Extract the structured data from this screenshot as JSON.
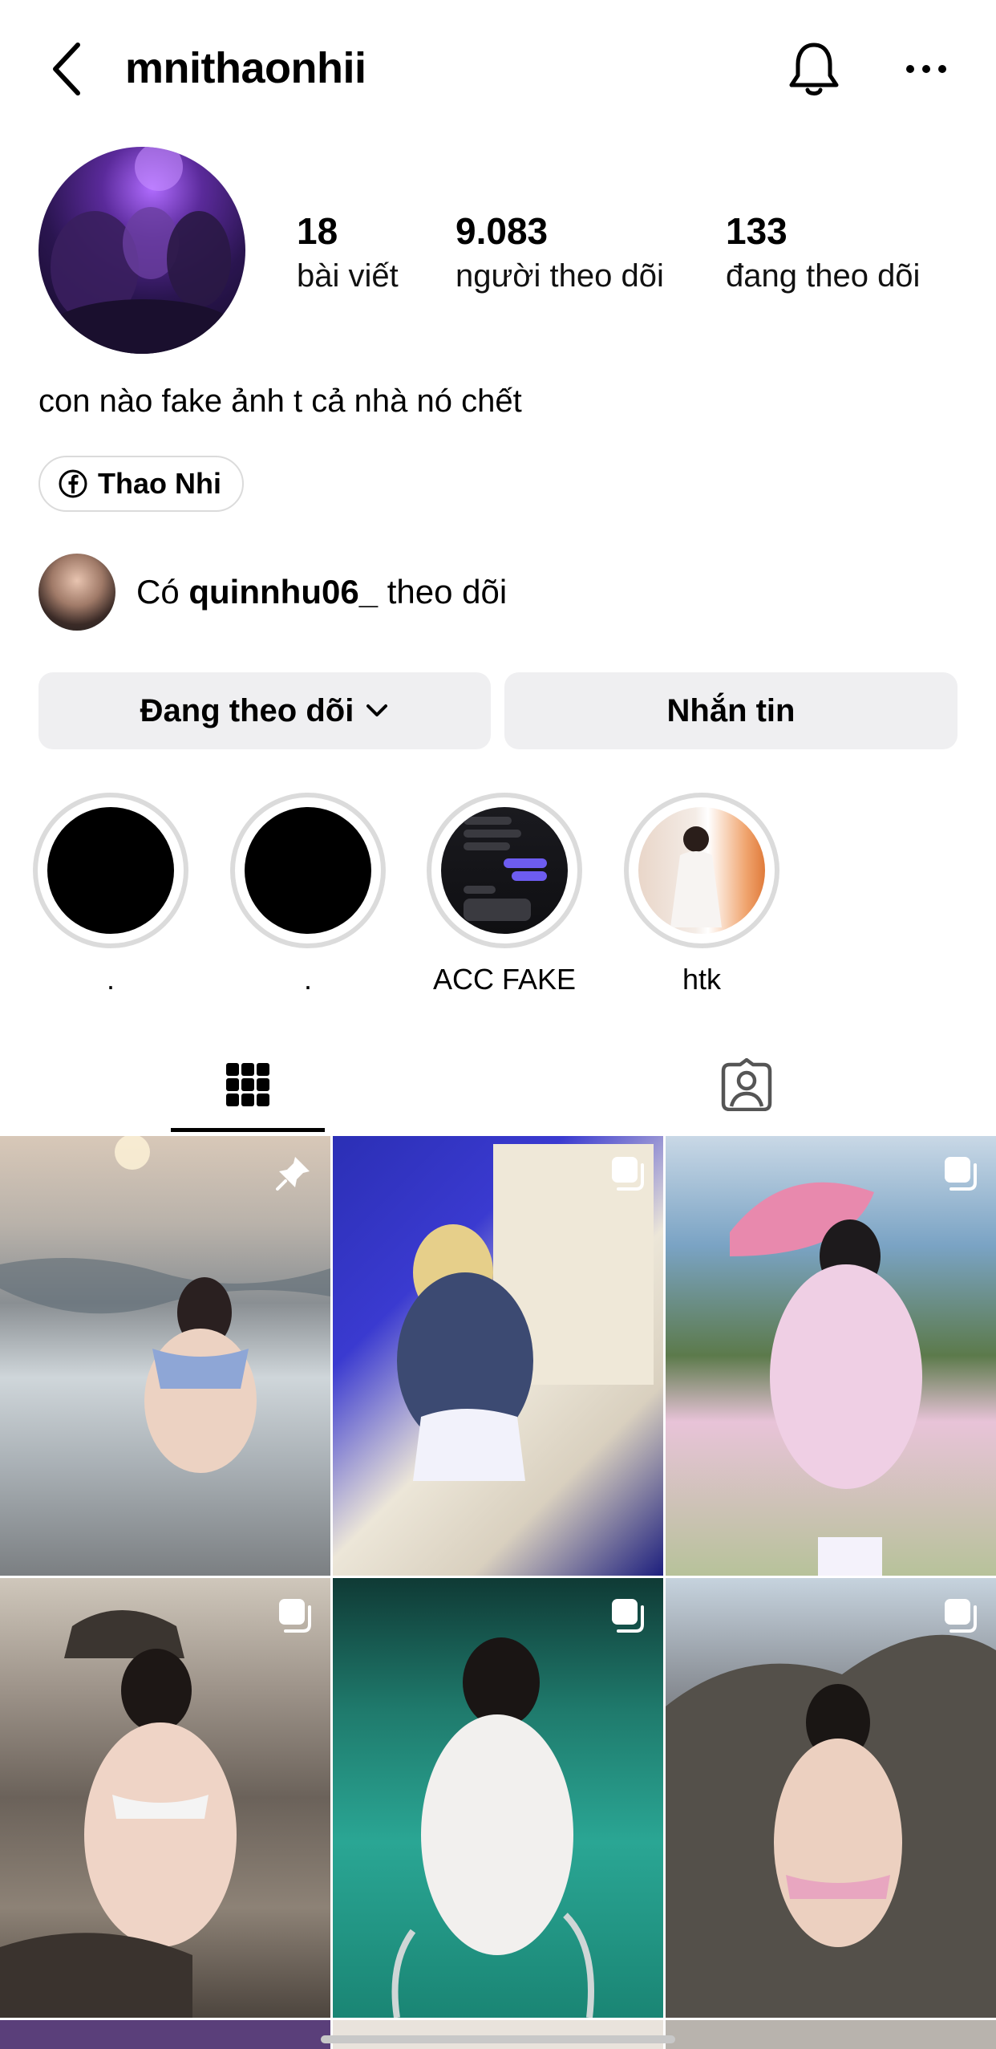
{
  "header": {
    "username": "mnithaonhii",
    "icons": {
      "back": "chevron-left-icon",
      "notifications": "bell-icon",
      "more": "more-horizontal-icon"
    }
  },
  "profile": {
    "stats": {
      "posts": {
        "value": "18",
        "label": "bài viết"
      },
      "followers": {
        "value": "9.083",
        "label": "người theo dõi"
      },
      "following": {
        "value": "133",
        "label": "đang theo dõi"
      }
    },
    "bio": "con nào fake ảnh t cả nhà nó chết",
    "link": {
      "icon": "facebook-icon",
      "label": "Thao Nhi"
    },
    "mutual": {
      "prefix": "Có",
      "username": "quinnhu06_",
      "suffix": "theo dõi"
    }
  },
  "actions": {
    "following_label": "Đang theo dõi",
    "message_label": "Nhắn tin"
  },
  "highlights": [
    {
      "label": "."
    },
    {
      "label": "."
    },
    {
      "label": "ACC FAKE"
    },
    {
      "label": "htk"
    }
  ],
  "tabs": [
    {
      "icon": "grid-icon",
      "active": true
    },
    {
      "icon": "tagged-person-icon",
      "active": false
    }
  ],
  "grid": {
    "posts": [
      {
        "badge": "pin-icon"
      },
      {
        "badge": "carousel-icon"
      },
      {
        "badge": "carousel-icon"
      },
      {
        "badge": "carousel-icon"
      },
      {
        "badge": "carousel-icon"
      },
      {
        "badge": "carousel-icon"
      }
    ]
  },
  "colors": {
    "button_bg": "#efeff1",
    "highlight_ring": "#dbdbdb",
    "text": "#000000"
  }
}
